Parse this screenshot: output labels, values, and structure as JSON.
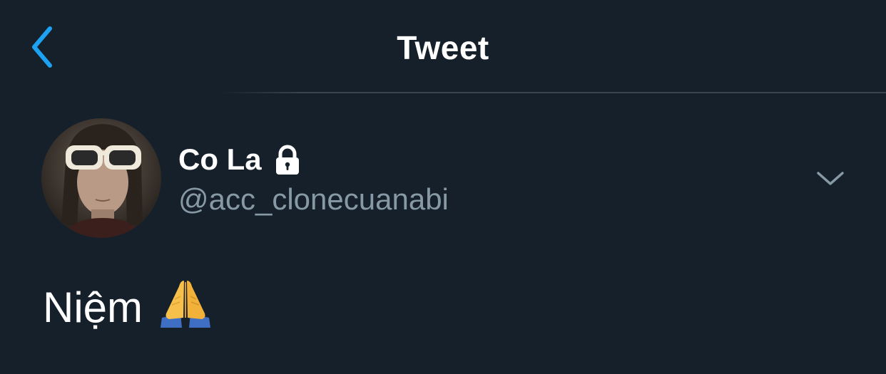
{
  "header": {
    "title": "Tweet",
    "back_icon": "chevron-left-icon",
    "accent_color": "#1da1f2"
  },
  "tweet": {
    "author": {
      "display_name": "Co La",
      "handle": "@acc_clonecuanabi",
      "protected_icon": "lock-icon",
      "avatar": "avatar-photo"
    },
    "more_icon": "chevron-down-icon",
    "text": "Niệm",
    "emoji_icon": "folded-hands-emoji-icon"
  },
  "colors": {
    "background": "#15202b",
    "primary_text": "#ffffff",
    "secondary_text": "#8899a6",
    "divider": "#38444d"
  }
}
